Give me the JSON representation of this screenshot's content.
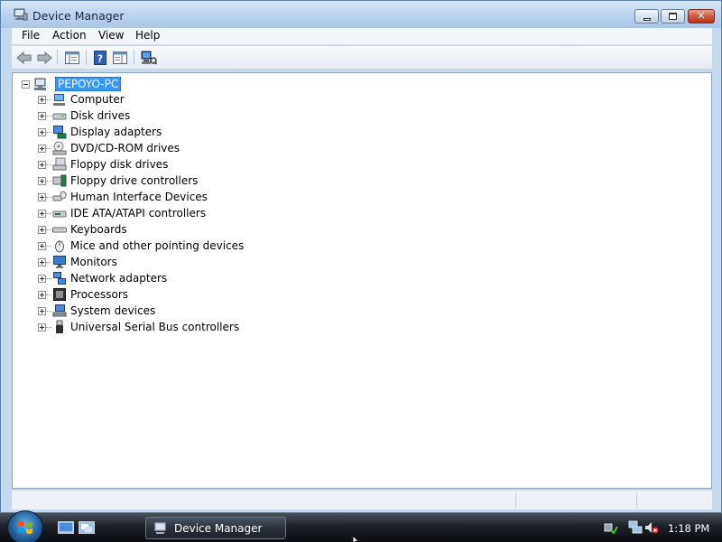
{
  "window": {
    "title": "Device Manager",
    "controls": {
      "minimize": "minimize-icon",
      "maximize": "maximize-icon",
      "close": "close-icon"
    }
  },
  "menu": [
    {
      "label": "File"
    },
    {
      "label": "Action"
    },
    {
      "label": "View"
    },
    {
      "label": "Help"
    }
  ],
  "toolbar": {
    "icons": [
      "back-arrow-icon",
      "forward-arrow-icon",
      "show-hide-console-tree-icon",
      "help-icon",
      "show-action-pane-icon",
      "scan-hardware-changes-icon"
    ]
  },
  "tree": {
    "root": {
      "label": "PEPOYO-PC",
      "icon": "computer-icon",
      "expanded": true,
      "selected": true
    },
    "categories": [
      {
        "label": "Computer",
        "icon": "computer-icon"
      },
      {
        "label": "Disk drives",
        "icon": "disk-drive-icon"
      },
      {
        "label": "Display adapters",
        "icon": "display-adapter-icon"
      },
      {
        "label": "DVD/CD-ROM drives",
        "icon": "dvd-drive-icon"
      },
      {
        "label": "Floppy disk drives",
        "icon": "floppy-drive-icon"
      },
      {
        "label": "Floppy drive controllers",
        "icon": "floppy-controller-icon"
      },
      {
        "label": "Human Interface Devices",
        "icon": "hid-icon"
      },
      {
        "label": "IDE ATA/ATAPI controllers",
        "icon": "ide-controller-icon"
      },
      {
        "label": "Keyboards",
        "icon": "keyboard-icon"
      },
      {
        "label": "Mice and other pointing devices",
        "icon": "mouse-icon"
      },
      {
        "label": "Monitors",
        "icon": "monitor-icon"
      },
      {
        "label": "Network adapters",
        "icon": "network-adapter-icon"
      },
      {
        "label": "Processors",
        "icon": "processor-icon"
      },
      {
        "label": "System devices",
        "icon": "system-devices-icon"
      },
      {
        "label": "Universal Serial Bus controllers",
        "icon": "usb-icon"
      }
    ]
  },
  "taskbar": {
    "start": "windows-start-orb-icon",
    "quick_launch": [
      "show-desktop-icon",
      "switch-windows-icon"
    ],
    "task_button_label": "Device Manager",
    "tray_icons": [
      "network-status-icon",
      "network-connection-icon",
      "volume-muted-icon"
    ],
    "clock": "1:18 PM"
  },
  "colors": {
    "selection": "#3399ff",
    "titlebar": "#bdd4ee",
    "taskbar": "#1c2026",
    "close_button": "#cf5a3f"
  }
}
